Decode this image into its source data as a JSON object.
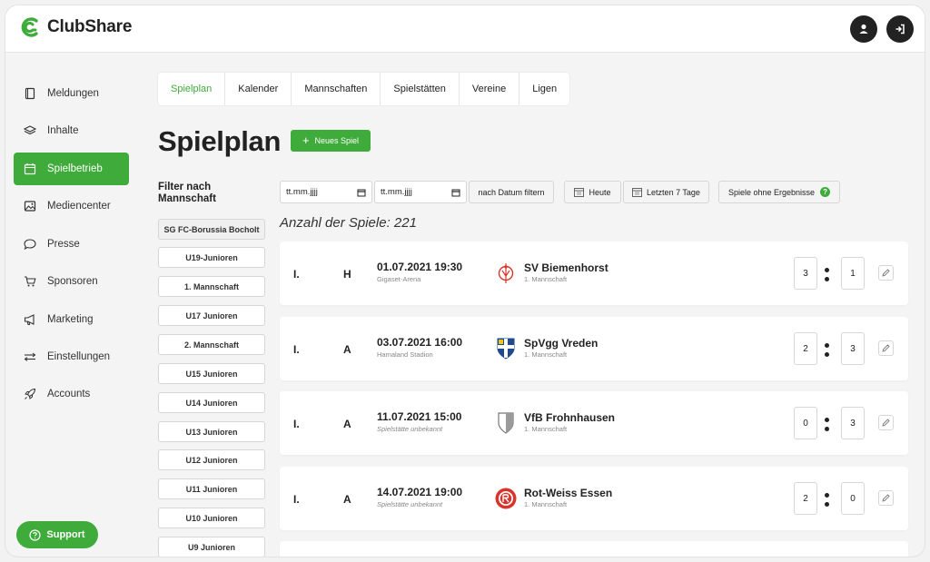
{
  "app": {
    "name": "ClubShare",
    "brand_color": "#3fab3a"
  },
  "header": {
    "profile_icon": "user-icon",
    "logout_icon": "logout-icon"
  },
  "sidebar": {
    "items": [
      {
        "label": "Meldungen",
        "icon": "book-icon"
      },
      {
        "label": "Inhalte",
        "icon": "layers-icon"
      },
      {
        "label": "Spielbetrieb",
        "icon": "calendar-icon",
        "active": true
      },
      {
        "label": "Mediencenter",
        "icon": "image-icon"
      },
      {
        "label": "Presse",
        "icon": "chat-icon"
      },
      {
        "label": "Sponsoren",
        "icon": "cart-icon"
      },
      {
        "label": "Marketing",
        "icon": "megaphone-icon"
      },
      {
        "label": "Einstellungen",
        "icon": "sliders-icon"
      },
      {
        "label": "Accounts",
        "icon": "rocket-icon"
      }
    ],
    "support_label": "Support"
  },
  "tabs": [
    "Spielplan",
    "Kalender",
    "Mannschaften",
    "Spielstätten",
    "Vereine",
    "Ligen"
  ],
  "page": {
    "title": "Spielplan",
    "new_button": "Neues Spiel",
    "filter_heading": "Filter nach Mannschaft",
    "date_from_placeholder": "tt.mm.jjjj",
    "date_to_placeholder": "tt.mm.jjjj",
    "filter_date_button": "nach Datum filtern",
    "today_button": "Heute",
    "last7_button": "Letzten 7 Tage",
    "no_results_button": "Spiele ohne Ergebnisse",
    "count_text": "Anzahl der Spiele: 221"
  },
  "teams": [
    "SG FC-Borussia Bocholt",
    "U19-Junioren",
    "1. Mannschaft",
    "U17 Junioren",
    "2. Mannschaft",
    "U15 Junioren",
    "U14 Junioren",
    "U13 Junioren",
    "U12 Junioren",
    "U11 Junioren",
    "U10 Junioren",
    "U9 Junioren"
  ],
  "games": [
    {
      "league": "I.",
      "ha": "H",
      "datetime": "01.07.2021 19:30",
      "venue": "Gigaset-Arena",
      "venue_unknown": false,
      "opponent": "SV Biemenhorst",
      "team": "1. Mannschaft",
      "score_home": "3",
      "score_away": "1",
      "crest_color": "#d9342b"
    },
    {
      "league": "I.",
      "ha": "A",
      "datetime": "03.07.2021 16:00",
      "venue": "Hamaland Stadion",
      "venue_unknown": false,
      "opponent": "SpVgg Vreden",
      "team": "1. Mannschaft",
      "score_home": "2",
      "score_away": "3",
      "crest_color": "#1f4b8e"
    },
    {
      "league": "I.",
      "ha": "A",
      "datetime": "11.07.2021 15:00",
      "venue": "Spielstätte unbekannt",
      "venue_unknown": true,
      "opponent": "VfB Frohnhausen",
      "team": "1. Mannschaft",
      "score_home": "0",
      "score_away": "3",
      "crest_color": "#9a9a9a"
    },
    {
      "league": "I.",
      "ha": "A",
      "datetime": "14.07.2021 19:00",
      "venue": "Spielstätte unbekannt",
      "venue_unknown": true,
      "opponent": "Rot-Weiss Essen",
      "team": "1. Mannschaft",
      "score_home": "2",
      "score_away": "0",
      "crest_color": "#d9342b"
    }
  ]
}
